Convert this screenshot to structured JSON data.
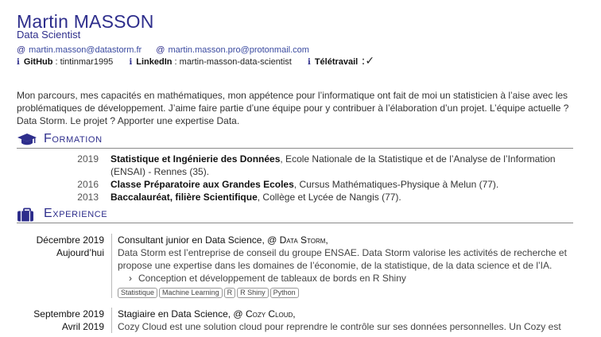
{
  "header": {
    "first_name": "Martin",
    "last_name": "MASSON",
    "role": "Data Scientist",
    "emails": [
      "martin.masson@datastorm.fr",
      "martin.masson.pro@protonmail.com"
    ],
    "github_label": "GitHub",
    "github_value": " : tintinmar1995",
    "linkedin_label": "LinkedIn",
    "linkedin_value": " : martin-masson-data-scientist",
    "remote_label": "Télétravail",
    "remote_value": " :✓"
  },
  "intro": "Mon parcours, mes capacités en mathématiques, mon appétence pour l’informatique ont fait de moi un statisticien à l’aise avec les problématiques de développement. J’aime faire partie d’une équipe pour y contribuer à l’élaboration d’un projet. L’équipe actuelle ? Data Storm. Le projet ? Apporter une expertise Data.",
  "formation": {
    "title": "Formation",
    "items": [
      {
        "year": "2019",
        "degree": "Statistique et Ingénierie des Données",
        "school": ", Ecole Nationale de la Statistique et de l’Analyse de l’Information (ENSAI) - Rennes (35)."
      },
      {
        "year": "2016",
        "degree": "Classe Préparatoire aux Grandes Ecoles",
        "school": ", Cursus Mathématiques-Physique à Melun (77)."
      },
      {
        "year": "2013",
        "degree": "Baccalauréat, filière Scientifique",
        "school": ", Collège et Lycée de Nangis (77)."
      }
    ]
  },
  "experience": {
    "title": "Experience",
    "items": [
      {
        "date_start": "Décembre 2019",
        "date_end": "Aujourd’hui",
        "role": "Consultant junior en Data Science, @",
        "company": "Data Storm,",
        "description": "Data Storm est l’entreprise de conseil du groupe ENSAE. Data Storm valorise les activités de recherche et propose une expertise dans les domaines de l’économie, de la statistique, de la data science et de l’IA.",
        "bullet": "Conception et développement de tableaux de bords en R Shiny",
        "tags": [
          "Statistique",
          "Machine Learning",
          "R",
          "R Shiny",
          "Python"
        ]
      },
      {
        "date_start": "Septembre 2019",
        "date_end": "Avril 2019",
        "role": "Stagiaire en Data Science, @",
        "company": "Cozy Cloud,",
        "description": "Cozy Cloud est une solution cloud pour reprendre le contrôle sur ses données personnelles. Un Cozy est"
      }
    ]
  }
}
